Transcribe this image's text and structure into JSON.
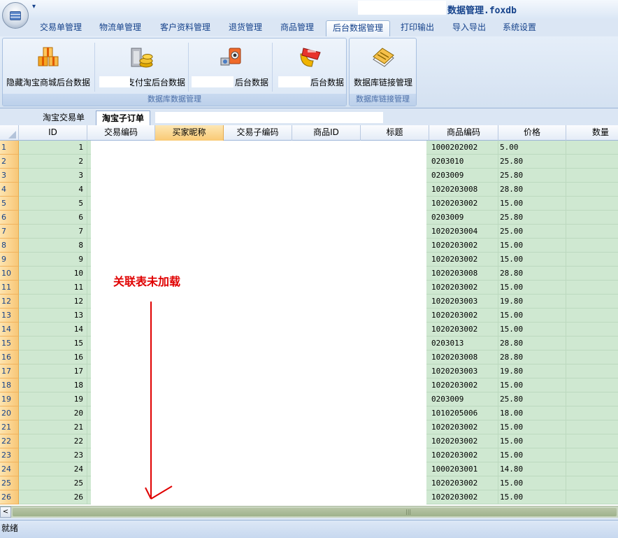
{
  "title_bar": {
    "app_title": "数据管理.foxdb",
    "qat_label": "▾"
  },
  "ribbon_tabs": [
    "交易单管理",
    "物流单管理",
    "客户资料管理",
    "退货管理",
    "商品管理",
    "后台数据管理",
    "打印输出",
    "导入导出",
    "系统设置"
  ],
  "active_tab": "后台数据管理",
  "ribbon": {
    "group1": {
      "label": "数据库数据管理",
      "buttons": [
        {
          "label": "隐藏淘宝商城后台数据",
          "icon": "boxes-icon"
        },
        {
          "label": "支付宝后台数据",
          "icon": "coins-icon"
        },
        {
          "label": "后台数据",
          "icon": "webcam-icon"
        },
        {
          "label": "后台数据",
          "icon": "magnet-icon"
        }
      ]
    },
    "group2": {
      "label": "数据库链接管理",
      "buttons": [
        {
          "label": "数据库链接管理",
          "icon": "notebook-icon"
        }
      ]
    }
  },
  "doc_tabs": [
    "淘宝交易单",
    "淘宝子订单"
  ],
  "active_doc_tab": "淘宝子订单",
  "grid": {
    "columns": [
      "ID",
      "交易编码",
      "买家昵称",
      "交易子编码",
      "商品ID",
      "标题",
      "商品编码",
      "价格",
      "数量"
    ],
    "selected_column": "买家昵称",
    "rows": [
      {
        "rn": "1",
        "id": "1",
        "code": "1000202002",
        "price": "5.00"
      },
      {
        "rn": "2",
        "id": "2",
        "code": "0203010",
        "price": "25.80"
      },
      {
        "rn": "3",
        "id": "3",
        "code": "0203009",
        "price": "25.80"
      },
      {
        "rn": "4",
        "id": "4",
        "code": "1020203008",
        "price": "28.80"
      },
      {
        "rn": "5",
        "id": "5",
        "code": "1020203002",
        "price": "15.00"
      },
      {
        "rn": "6",
        "id": "6",
        "code": "0203009",
        "price": "25.80"
      },
      {
        "rn": "7",
        "id": "7",
        "code": "1020203004",
        "price": "25.00"
      },
      {
        "rn": "8",
        "id": "8",
        "code": "1020203002",
        "price": "15.00"
      },
      {
        "rn": "9",
        "id": "9",
        "code": "1020203002",
        "price": "15.00"
      },
      {
        "rn": "10",
        "id": "10",
        "code": "1020203008",
        "price": "28.80"
      },
      {
        "rn": "11",
        "id": "11",
        "code": "1020203002",
        "price": "15.00"
      },
      {
        "rn": "12",
        "id": "12",
        "code": "1020203003",
        "price": "19.80"
      },
      {
        "rn": "13",
        "id": "13",
        "code": "1020203002",
        "price": "15.00"
      },
      {
        "rn": "14",
        "id": "14",
        "code": "1020203002",
        "price": "15.00"
      },
      {
        "rn": "15",
        "id": "15",
        "code": "0203013",
        "price": "28.80"
      },
      {
        "rn": "16",
        "id": "16",
        "code": "1020203008",
        "price": "28.80"
      },
      {
        "rn": "17",
        "id": "17",
        "code": "1020203003",
        "price": "19.80"
      },
      {
        "rn": "18",
        "id": "18",
        "code": "1020203002",
        "price": "15.00"
      },
      {
        "rn": "19",
        "id": "19",
        "code": "0203009",
        "price": "25.80"
      },
      {
        "rn": "20",
        "id": "20",
        "code": "1010205006",
        "price": "18.00"
      },
      {
        "rn": "21",
        "id": "21",
        "code": "1020203002",
        "price": "15.00"
      },
      {
        "rn": "22",
        "id": "22",
        "code": "1020203002",
        "price": "15.00"
      },
      {
        "rn": "23",
        "id": "23",
        "code": "1020203002",
        "price": "15.00"
      },
      {
        "rn": "24",
        "id": "24",
        "code": "1000203001",
        "price": "14.80"
      },
      {
        "rn": "25",
        "id": "25",
        "code": "1020203002",
        "price": "15.00"
      },
      {
        "rn": "26",
        "id": "26",
        "code": "1020203002",
        "price": "15.00"
      }
    ]
  },
  "annotation": {
    "text": "关联表未加载",
    "color": "#e00000"
  },
  "status_bar": {
    "text": "就绪"
  },
  "scrollbar": {
    "left_arrow": "<",
    "grip": "|||"
  },
  "colors": {
    "row_fill": "#cfe8d1",
    "row_header": "#f8c777",
    "ribbon_text": "#15428b"
  }
}
